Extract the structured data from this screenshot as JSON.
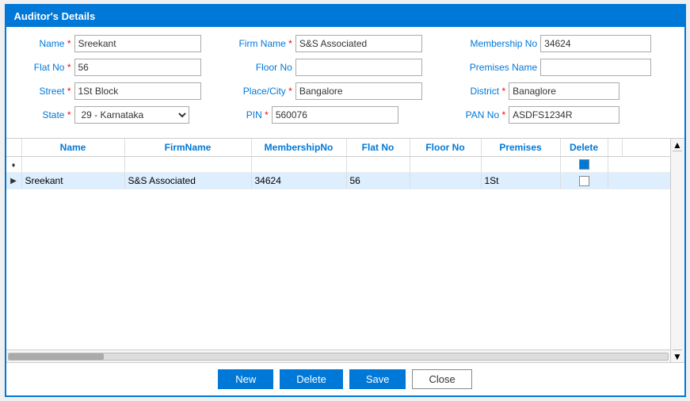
{
  "dialog": {
    "title": "Auditor's Details"
  },
  "form": {
    "name_label": "Name",
    "name_value": "Sreekant",
    "firm_name_label": "Firm Name",
    "firm_name_value": "S&S Associated",
    "membership_no_label": "Membership No",
    "membership_no_value": "34624",
    "flat_no_label": "Flat No",
    "flat_no_value": "56",
    "floor_no_label": "Floor No",
    "floor_no_value": "",
    "premises_name_label": "Premises Name",
    "premises_name_value": "",
    "street_label": "Street",
    "street_value": "1St Block",
    "place_city_label": "Place/City",
    "place_city_value": "Bangalore",
    "district_label": "District",
    "district_value": "Banaglore",
    "state_label": "State",
    "state_value": "29 - Karnataka",
    "pin_label": "PIN",
    "pin_value": "560076",
    "pan_no_label": "PAN No",
    "pan_no_value": "ASDFS1234R"
  },
  "grid": {
    "headers": [
      "Name",
      "FirmName",
      "MembershipNo",
      "Flat No",
      "Floor No",
      "Premises",
      "Delete"
    ],
    "rows": [
      {
        "indicator": "",
        "name": "",
        "firm_name": "",
        "membership_no": "",
        "flat_no": "",
        "floor_no": "",
        "premises": "",
        "delete": true
      },
      {
        "indicator": "▶",
        "name": "Sreekant",
        "firm_name": "S&S Associated",
        "membership_no": "34624",
        "flat_no": "56",
        "floor_no": "",
        "premises": "1St",
        "delete": false
      }
    ]
  },
  "footer": {
    "new_label": "New",
    "delete_label": "Delete",
    "save_label": "Save",
    "close_label": "Close"
  }
}
